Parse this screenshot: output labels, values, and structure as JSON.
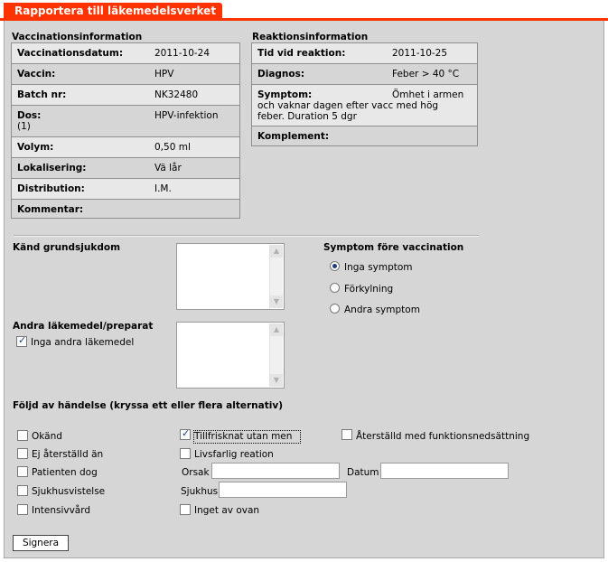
{
  "tab": {
    "title": "Rapportera till läkemedelsverket"
  },
  "vaccination": {
    "title": "Vaccinationsinformation",
    "rows": [
      {
        "label": "Vaccinationsdatum:",
        "value": "2011-10-24"
      },
      {
        "label": "Vaccin:",
        "value": "HPV"
      },
      {
        "label": "Batch nr:",
        "value": "NK32480"
      },
      {
        "label": "Dos:",
        "sub": "(1)",
        "value": "HPV-infektion"
      },
      {
        "label": "Volym:",
        "value": "0,50 ml"
      },
      {
        "label": "Lokalisering:",
        "value": "Vä lår"
      },
      {
        "label": "Distribution:",
        "value": "I.M."
      },
      {
        "label": "Kommentar:",
        "value": ""
      }
    ]
  },
  "reaction": {
    "title": "Reaktionsinformation",
    "rows": [
      {
        "label": "Tid vid reaktion:",
        "value": "2011-10-25"
      },
      {
        "label": "Diagnos:",
        "value": "Feber > 40 °C"
      },
      {
        "label": "Symptom:",
        "value": "Ömhet i armen",
        "cont1": "och vaknar dagen efter vacc med hög",
        "cont2": "feber. Duration 5 dgr"
      },
      {
        "label": "Komplement:",
        "value": ""
      }
    ]
  },
  "known_disease": {
    "label": "Känd grundsjukdom"
  },
  "other_meds": {
    "label": "Andra läkemedel/preparat",
    "checkbox": "Inga andra läkemedel",
    "checked": true
  },
  "symptoms_before": {
    "title": "Symptom före vaccination",
    "options": [
      "Inga symptom",
      "Förkylning",
      "Andra symptom"
    ],
    "selected": 0
  },
  "outcome": {
    "title": "Följd av händelse (kryssa ett eller flera alternativ)",
    "col1": [
      "Okänd",
      "Ej återställd än",
      "Patienten dog",
      "Sjukhusvistelse",
      "Intensivvård"
    ],
    "col2": [
      "Tillfrisknat utan men",
      "Livsfarlig reation",
      "Inget av ovan"
    ],
    "col3": [
      "Återställd med funktionsnedsättning"
    ],
    "orsak_label": "Orsak",
    "datum_label": "Datum",
    "sjukhus_label": "Sjukhus"
  },
  "submit": {
    "label": "Signera"
  }
}
